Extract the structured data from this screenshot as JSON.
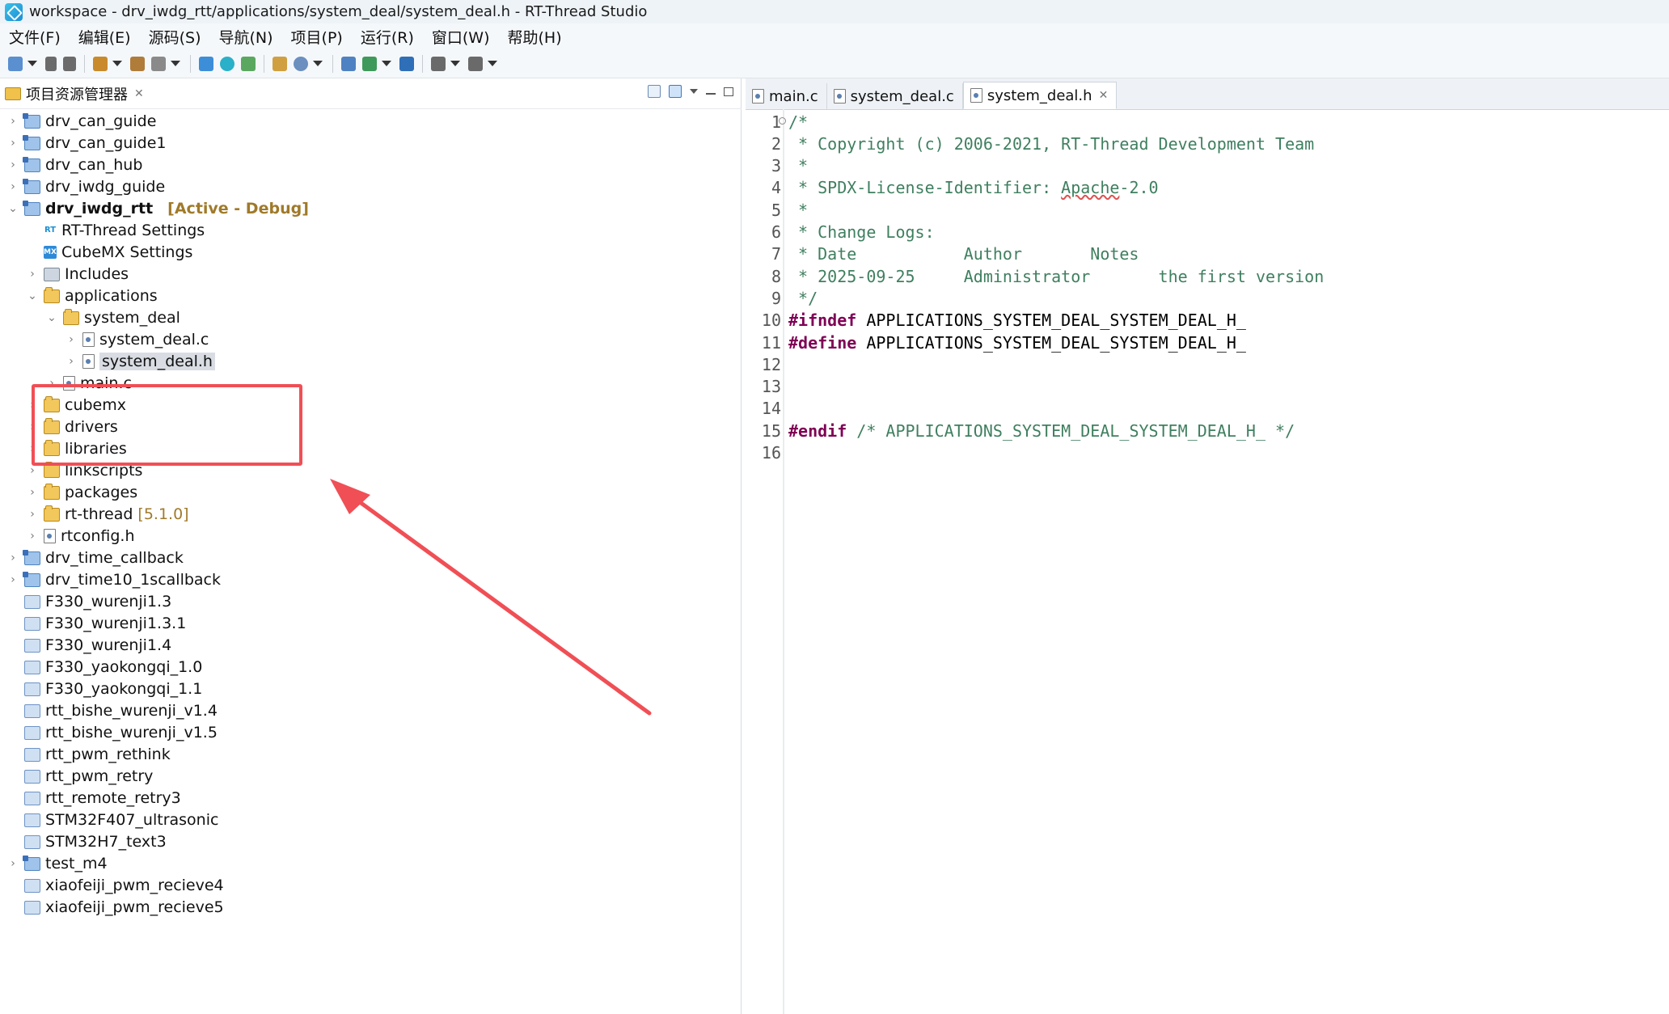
{
  "window": {
    "title": "workspace - drv_iwdg_rtt/applications/system_deal/system_deal.h - RT-Thread Studio"
  },
  "menu": [
    "文件(F)",
    "编辑(E)",
    "源码(S)",
    "导航(N)",
    "项目(P)",
    "运行(R)",
    "窗口(W)",
    "帮助(H)"
  ],
  "project_explorer": {
    "title": "项目资源管理器",
    "tree": [
      {
        "label": "drv_can_guide",
        "icon": "project-icon",
        "expander": "collapsed"
      },
      {
        "label": "drv_can_guide1",
        "icon": "project-icon",
        "expander": "collapsed"
      },
      {
        "label": "drv_can_hub",
        "icon": "project-icon",
        "expander": "collapsed"
      },
      {
        "label": "drv_iwdg_guide",
        "icon": "project-icon",
        "expander": "collapsed"
      },
      {
        "label": "drv_iwdg_rtt",
        "icon": "project-icon",
        "expander": "expanded",
        "tag": "[Active - Debug]"
      },
      {
        "label": "RT-Thread Settings",
        "icon": "rt-thread-settings-icon",
        "expander": "none"
      },
      {
        "label": "CubeMX Settings",
        "icon": "cubemx-icon",
        "expander": "none"
      },
      {
        "label": "Includes",
        "icon": "includes-icon",
        "expander": "collapsed"
      },
      {
        "label": "applications",
        "icon": "folder-icon",
        "expander": "expanded"
      },
      {
        "label": "system_deal",
        "icon": "folder-icon",
        "expander": "expanded"
      },
      {
        "label": "system_deal.c",
        "icon": "c-file-icon",
        "expander": "collapsed"
      },
      {
        "label": "system_deal.h",
        "icon": "h-file-icon",
        "expander": "collapsed"
      },
      {
        "label": "main.c",
        "icon": "c-file-icon",
        "expander": "collapsed"
      },
      {
        "label": "cubemx",
        "icon": "folder-icon",
        "expander": "collapsed"
      },
      {
        "label": "drivers",
        "icon": "folder-icon",
        "expander": "collapsed"
      },
      {
        "label": "libraries",
        "icon": "folder-icon",
        "expander": "collapsed"
      },
      {
        "label": "linkscripts",
        "icon": "folder-icon",
        "expander": "collapsed"
      },
      {
        "label": "packages",
        "icon": "folder-icon",
        "expander": "collapsed"
      },
      {
        "label": "rt-thread",
        "icon": "folder-icon",
        "expander": "collapsed",
        "version": "[5.1.0]"
      },
      {
        "label": "rtconfig.h",
        "icon": "h-file-icon",
        "expander": "collapsed"
      },
      {
        "label": "drv_time_callback",
        "icon": "project-icon",
        "expander": "collapsed"
      },
      {
        "label": "drv_time10_1scallback",
        "icon": "project-icon",
        "expander": "collapsed"
      },
      {
        "label": "F330_wurenji1.3",
        "icon": "closed-project-icon",
        "expander": "none"
      },
      {
        "label": "F330_wurenji1.3.1",
        "icon": "closed-project-icon",
        "expander": "none"
      },
      {
        "label": "F330_wurenji1.4",
        "icon": "closed-project-icon",
        "expander": "none"
      },
      {
        "label": "F330_yaokongqi_1.0",
        "icon": "closed-project-icon",
        "expander": "none"
      },
      {
        "label": "F330_yaokongqi_1.1",
        "icon": "closed-project-icon",
        "expander": "none"
      },
      {
        "label": "rtt_bishe_wurenji_v1.4",
        "icon": "closed-project-icon",
        "expander": "none"
      },
      {
        "label": "rtt_bishe_wurenji_v1.5",
        "icon": "closed-project-icon",
        "expander": "none"
      },
      {
        "label": "rtt_pwm_rethink",
        "icon": "closed-project-icon",
        "expander": "none"
      },
      {
        "label": "rtt_pwm_retry",
        "icon": "closed-project-icon",
        "expander": "none"
      },
      {
        "label": "rtt_remote_retry3",
        "icon": "closed-project-icon",
        "expander": "none"
      },
      {
        "label": "STM32F407_ultrasonic",
        "icon": "closed-project-icon",
        "expander": "none"
      },
      {
        "label": "STM32H7_text3",
        "icon": "closed-project-icon",
        "expander": "none"
      },
      {
        "label": "test_m4",
        "icon": "project-icon",
        "expander": "collapsed"
      },
      {
        "label": "xiaofeiji_pwm_recieve4",
        "icon": "closed-project-icon",
        "expander": "none"
      },
      {
        "label": "xiaofeiji_pwm_recieve5",
        "icon": "closed-project-icon",
        "expander": "none"
      }
    ]
  },
  "editor": {
    "tabs": [
      {
        "label": "main.c",
        "active": false
      },
      {
        "label": "system_deal.c",
        "active": false
      },
      {
        "label": "system_deal.h",
        "active": true
      }
    ],
    "lines": [
      {
        "n": "1",
        "parts": [
          {
            "t": "/*",
            "c": "comment"
          }
        ]
      },
      {
        "n": "2",
        "parts": [
          {
            "t": " * Copyright (c) 2006-2021, RT-Thread Development Team",
            "c": "comment"
          }
        ]
      },
      {
        "n": "3",
        "parts": [
          {
            "t": " *",
            "c": "comment"
          }
        ]
      },
      {
        "n": "4",
        "parts": [
          {
            "t": " * SPDX-License-Identifier: ",
            "c": "comment"
          },
          {
            "t": "Apache",
            "c": "comment-spell"
          },
          {
            "t": "-2.0",
            "c": "comment"
          }
        ]
      },
      {
        "n": "5",
        "parts": [
          {
            "t": " *",
            "c": "comment"
          }
        ]
      },
      {
        "n": "6",
        "parts": [
          {
            "t": " * Change Logs:",
            "c": "comment"
          }
        ]
      },
      {
        "n": "7",
        "parts": [
          {
            "t": " * Date           Author       Notes",
            "c": "comment"
          }
        ]
      },
      {
        "n": "8",
        "parts": [
          {
            "t": " * 2025-09-25     Administrator       the first version",
            "c": "comment"
          }
        ]
      },
      {
        "n": "9",
        "parts": [
          {
            "t": " */",
            "c": "comment"
          }
        ]
      },
      {
        "n": "10",
        "parts": [
          {
            "t": "#ifndef",
            "c": "directive"
          },
          {
            "t": " APPLICATIONS_SYSTEM_DEAL_SYSTEM_DEAL_H_",
            "c": "plain"
          }
        ]
      },
      {
        "n": "11",
        "parts": [
          {
            "t": "#define",
            "c": "directive"
          },
          {
            "t": " APPLICATIONS_SYSTEM_DEAL_SYSTEM_DEAL_H_",
            "c": "plain"
          }
        ]
      },
      {
        "n": "12",
        "parts": []
      },
      {
        "n": "13",
        "parts": []
      },
      {
        "n": "14",
        "parts": []
      },
      {
        "n": "15",
        "parts": [
          {
            "t": "#endif",
            "c": "directive"
          },
          {
            "t": " /* APPLICATIONS_SYSTEM_DEAL_SYSTEM_DEAL_H_ */",
            "c": "comment"
          }
        ]
      },
      {
        "n": "16",
        "parts": []
      }
    ]
  },
  "colors": {
    "comment": "#3f7f5f",
    "directive": "#7f0055",
    "highlight": "#f04f55",
    "active_tag": "#a07a2a"
  }
}
